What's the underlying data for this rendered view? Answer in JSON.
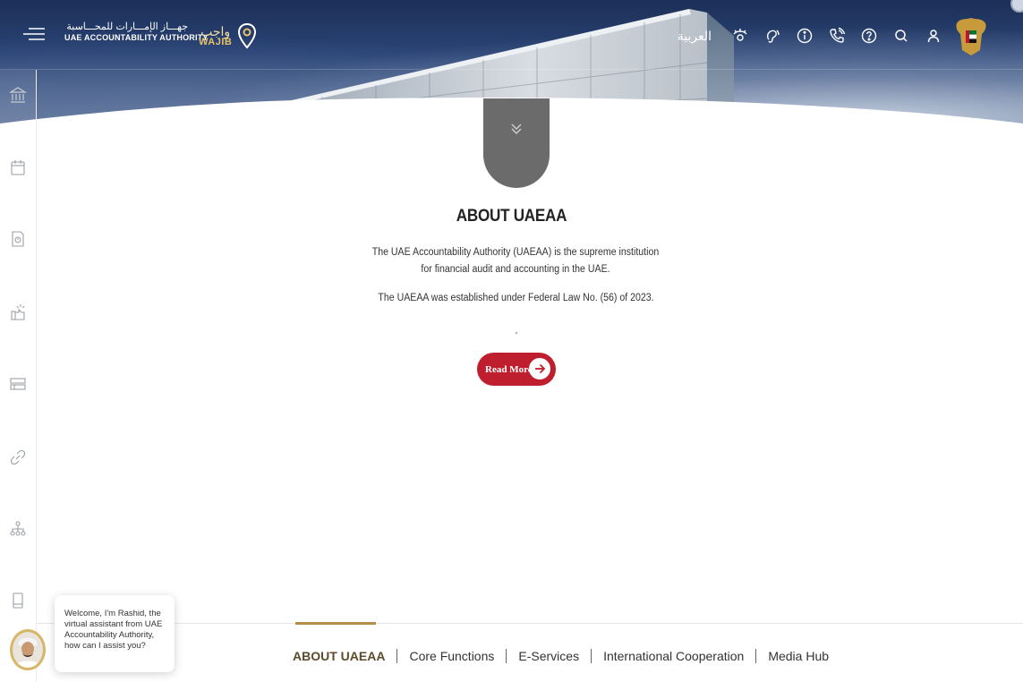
{
  "header": {
    "logo_ar": "جهـــاز الإمـــارات للمحـــاسبة",
    "logo_en": "UAE ACCOUNTABILITY AUTHORITY",
    "wajib_ar": "واجب",
    "wajib_en": "WAJIB",
    "language_toggle": "العربية",
    "tools": [
      {
        "icon": "eye-accessibility-icon"
      },
      {
        "icon": "hearing-icon"
      },
      {
        "icon": "info-icon"
      },
      {
        "icon": "phone-icon"
      },
      {
        "icon": "help-icon"
      },
      {
        "icon": "search-icon"
      },
      {
        "icon": "user-icon"
      }
    ]
  },
  "rail": {
    "items": [
      {
        "icon": "institution-icon"
      },
      {
        "icon": "calendar-icon"
      },
      {
        "icon": "document-icon"
      },
      {
        "icon": "ideas-icon"
      },
      {
        "icon": "services-icon"
      },
      {
        "icon": "link-icon"
      },
      {
        "icon": "org-chart-icon"
      },
      {
        "icon": "mobile-icon"
      }
    ]
  },
  "about": {
    "title": "ABOUT UAEAA",
    "paragraph1": "The UAE Accountability Authority (UAEAA) is the supreme institution for financial audit and accounting in the UAE.",
    "paragraph2": "The UAEAA was established under Federal Law No. (56) of 2023.",
    "read_more": "Read More"
  },
  "bottom_nav": {
    "items": [
      {
        "label": "ABOUT UAEAA",
        "active": true
      },
      {
        "label": "Core Functions",
        "active": false
      },
      {
        "label": "E-Services",
        "active": false
      },
      {
        "label": "International Cooperation",
        "active": false
      },
      {
        "label": "Media Hub",
        "active": false
      }
    ]
  },
  "chat": {
    "message": "Welcome, I'm Rashid, the virtual assistant from UAE Accountability Authority, how can I assist you?"
  },
  "colors": {
    "accent_red": "#bf1e2e",
    "gold": "#b58f4a",
    "header_navy": "#1c2f57"
  }
}
